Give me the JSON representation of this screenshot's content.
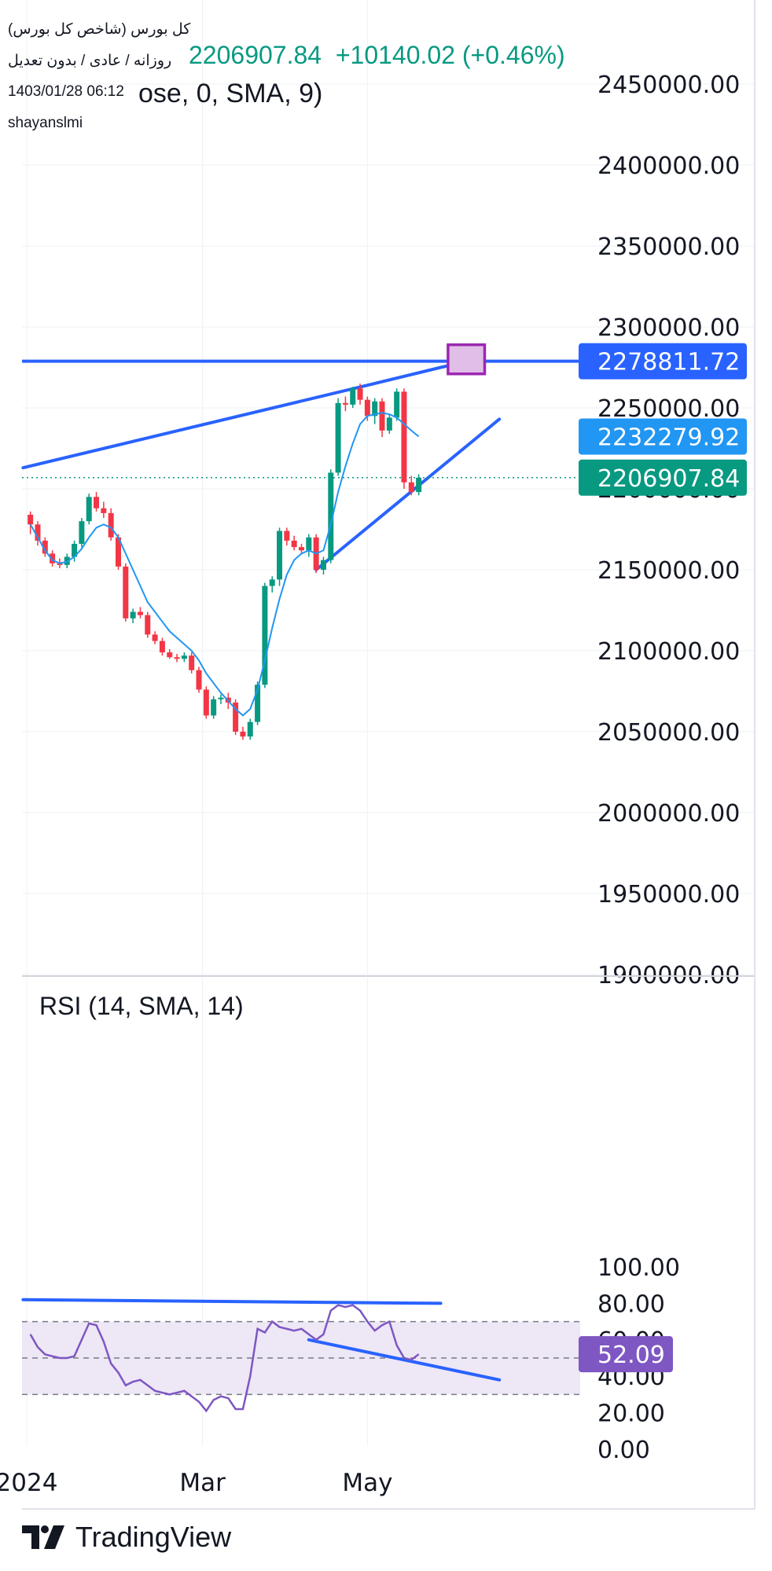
{
  "header": {
    "name": "کل بورس (شاخص کل بورس)",
    "sub": "روزانه / عادی / بدون تعدیل",
    "time": "1403/01/28 06:12",
    "author": "shayanslmi",
    "price": "2206907.84",
    "change": "+10140.02 (+0.46%)",
    "ma_fragment": "ose, 0, SMA, 9)"
  },
  "colors": {
    "up": "#089981",
    "down": "#f23645",
    "ma_line": "#2196f3",
    "trendline": "#2962ff",
    "rsi": "#7e57c2",
    "rsi_band": "#ede7f6",
    "box_border": "#9c27b0",
    "box_fill": "#e1bee7"
  },
  "chart_data": [
    {
      "type": "candlestick",
      "title": "",
      "y_range": [
        1870000,
        2480000
      ],
      "y_ticks": [
        "2450000.00",
        "2400000.00",
        "2350000.00",
        "2300000.00",
        "2250000.00",
        "2200000.00",
        "2150000.00",
        "2100000.00",
        "2050000.00",
        "2000000.00",
        "1950000.00",
        "1900000.00"
      ],
      "x_ticks": [
        "2024",
        "Mar",
        "May"
      ],
      "price_labels": [
        {
          "value": "2278811.72",
          "y": 2278811.72,
          "color": "#2962ff"
        },
        {
          "value": "2232279.92",
          "y": 2232279.92,
          "color": "#2196f3"
        },
        {
          "value": "2206907.84",
          "y": 2206907.84,
          "color": "#089981"
        }
      ],
      "last_close": 2206907.84,
      "candles": [
        [
          2184000,
          2186000,
          2172000,
          2178000
        ],
        [
          2178000,
          2180000,
          2165000,
          2168000
        ],
        [
          2168000,
          2170000,
          2158000,
          2160000
        ],
        [
          2160000,
          2162000,
          2152000,
          2154000
        ],
        [
          2154000,
          2157000,
          2151000,
          2153000
        ],
        [
          2153000,
          2160000,
          2151000,
          2158000
        ],
        [
          2158000,
          2168000,
          2155000,
          2166000
        ],
        [
          2166000,
          2182000,
          2164000,
          2180000
        ],
        [
          2180000,
          2197000,
          2178000,
          2195000
        ],
        [
          2195000,
          2198000,
          2186000,
          2188000
        ],
        [
          2188000,
          2192000,
          2182000,
          2185000
        ],
        [
          2185000,
          2188000,
          2168000,
          2170000
        ],
        [
          2170000,
          2172000,
          2150000,
          2152000
        ],
        [
          2152000,
          2154000,
          2118000,
          2120000
        ],
        [
          2120000,
          2126000,
          2117000,
          2124000
        ],
        [
          2124000,
          2127000,
          2120000,
          2122000
        ],
        [
          2122000,
          2124000,
          2108000,
          2110000
        ],
        [
          2110000,
          2112000,
          2104000,
          2106000
        ],
        [
          2106000,
          2108000,
          2097000,
          2099000
        ],
        [
          2099000,
          2101000,
          2095000,
          2096000
        ],
        [
          2096000,
          2098000,
          2093000,
          2095000
        ],
        [
          2095000,
          2099000,
          2093000,
          2097000
        ],
        [
          2097000,
          2099000,
          2086000,
          2088000
        ],
        [
          2088000,
          2090000,
          2074000,
          2076000
        ],
        [
          2076000,
          2078000,
          2058000,
          2060000
        ],
        [
          2060000,
          2072000,
          2058000,
          2070000
        ],
        [
          2070000,
          2073000,
          2067000,
          2071000
        ],
        [
          2071000,
          2074000,
          2064000,
          2068000
        ],
        [
          2068000,
          2070000,
          2048000,
          2050000
        ],
        [
          2050000,
          2053000,
          2045000,
          2047000
        ],
        [
          2047000,
          2058000,
          2045000,
          2056000
        ],
        [
          2056000,
          2081000,
          2054000,
          2079000
        ],
        [
          2079000,
          2142000,
          2077000,
          2140000
        ],
        [
          2140000,
          2146000,
          2136000,
          2144000
        ],
        [
          2144000,
          2176000,
          2140000,
          2174000
        ],
        [
          2174000,
          2176000,
          2165000,
          2168000
        ],
        [
          2168000,
          2171000,
          2162000,
          2164000
        ],
        [
          2164000,
          2166000,
          2160000,
          2162000
        ],
        [
          2162000,
          2172000,
          2158000,
          2170000
        ],
        [
          2170000,
          2172000,
          2148000,
          2150000
        ],
        [
          2150000,
          2158000,
          2147000,
          2156000
        ],
        [
          2156000,
          2212000,
          2154000,
          2210000
        ],
        [
          2210000,
          2256000,
          2208000,
          2253000
        ],
        [
          2253000,
          2257000,
          2248000,
          2252000
        ],
        [
          2252000,
          2263000,
          2250000,
          2262000
        ],
        [
          2262000,
          2265000,
          2252000,
          2255000
        ],
        [
          2255000,
          2257000,
          2242000,
          2245000
        ],
        [
          2245000,
          2256000,
          2240000,
          2254000
        ],
        [
          2254000,
          2256000,
          2232000,
          2236000
        ],
        [
          2236000,
          2246000,
          2234000,
          2244000
        ],
        [
          2244000,
          2262000,
          2242000,
          2260000
        ],
        [
          2260000,
          2262000,
          2200000,
          2204000
        ],
        [
          2204000,
          2208000,
          2196000,
          2198000
        ],
        [
          2198000,
          2209000,
          2196000,
          2206907.84
        ]
      ],
      "sma": [
        2178000,
        2170000,
        2162000,
        2156000,
        2154000,
        2155000,
        2158000,
        2163000,
        2170000,
        2176000,
        2178000,
        2176000,
        2170000,
        2160000,
        2150000,
        2140000,
        2130000,
        2124000,
        2118000,
        2112000,
        2108000,
        2104000,
        2100000,
        2094000,
        2086000,
        2080000,
        2074000,
        2069000,
        2064000,
        2060000,
        2064000,
        2076000,
        2094000,
        2114000,
        2132000,
        2147000,
        2156000,
        2160000,
        2162000,
        2160000,
        2162000,
        2178000,
        2198000,
        2214000,
        2228000,
        2240000,
        2245000,
        2246000,
        2247000,
        2246000,
        2244000,
        2240000,
        2236000,
        2232279.92
      ],
      "resistance": 2278811.72,
      "upper_trend": [
        [
          -1,
          2213000
        ],
        [
          46,
          2264000
        ],
        [
          56,
          2275000
        ],
        [
          60,
          2279000
        ]
      ],
      "lower_trend": [
        [
          39,
          2150000
        ],
        [
          64,
          2243000
        ]
      ],
      "target_box": {
        "x": [
          57,
          62
        ],
        "y": [
          2271000,
          2289000
        ]
      }
    },
    {
      "type": "line",
      "title": "RSI (14, SMA, 14)",
      "y_range": [
        0,
        100
      ],
      "y_ticks": [
        "100.00",
        "80.00",
        "60.00",
        "40.00",
        "20.00",
        "0.00"
      ],
      "band": [
        30,
        70
      ],
      "midline": 50,
      "last_label": "52.09",
      "rsi": [
        63,
        56,
        52,
        51,
        50,
        50,
        51,
        60,
        69,
        68,
        59,
        47,
        42,
        35,
        37,
        38,
        35,
        32,
        31,
        30,
        31,
        32,
        29,
        26,
        21,
        27,
        29,
        28,
        22,
        22,
        40,
        66,
        64,
        70,
        67,
        66,
        65,
        66,
        63,
        60,
        63,
        76,
        79,
        78,
        79,
        76,
        70,
        65,
        68,
        70,
        57,
        50,
        49,
        52.09
      ],
      "upper_trend": [
        [
          -1,
          82
        ],
        [
          56,
          80
        ]
      ],
      "lower_trend": [
        [
          38,
          60
        ],
        [
          64,
          38
        ]
      ]
    }
  ]
}
